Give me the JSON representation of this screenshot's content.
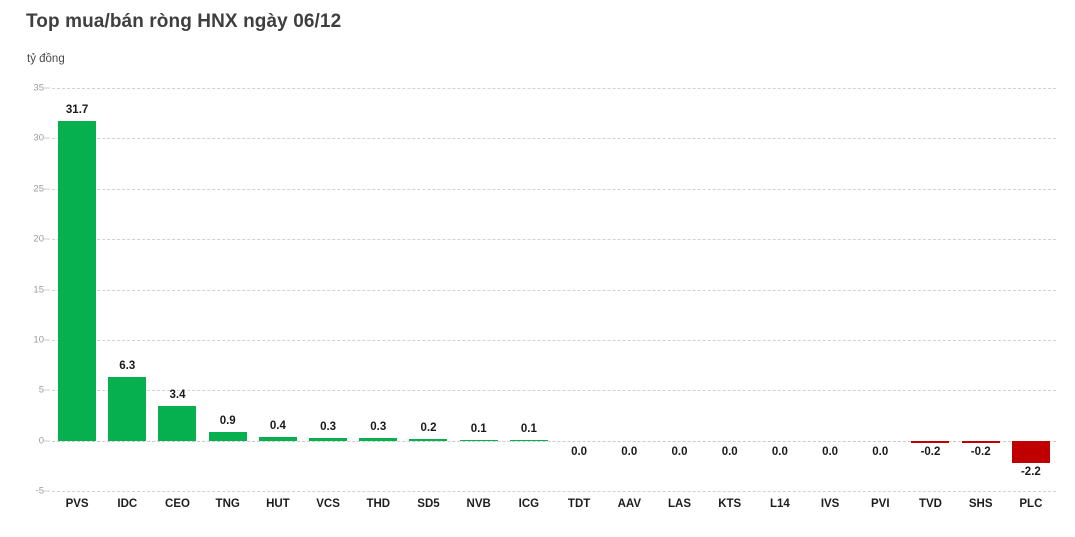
{
  "chart_data": {
    "type": "bar",
    "title": "Top mua/bán ròng HNX ngày 06/12",
    "subtitle": "",
    "unit_label": "tỷ đồng",
    "xlabel": "",
    "ylabel": "tỷ đồng",
    "ylim": [
      -5,
      35
    ],
    "yticks": [
      35,
      30,
      25,
      20,
      15,
      10,
      5,
      0,
      -5
    ],
    "ytick_labels": [
      "35",
      "30",
      "25",
      "20",
      "15",
      "10",
      "5",
      "0",
      "-5"
    ],
    "grid": true,
    "legend": "none",
    "categories": [
      "PVS",
      "IDC",
      "CEO",
      "TNG",
      "HUT",
      "VCS",
      "THD",
      "SD5",
      "NVB",
      "ICG",
      "TDT",
      "AAV",
      "LAS",
      "KTS",
      "L14",
      "IVS",
      "PVI",
      "TVD",
      "SHS",
      "PLC"
    ],
    "values": [
      31.7,
      6.3,
      3.4,
      0.9,
      0.4,
      0.3,
      0.3,
      0.2,
      0.1,
      0.1,
      0.0,
      0.0,
      0.0,
      0.0,
      0.0,
      0.0,
      0.0,
      -0.2,
      -0.2,
      -2.2
    ],
    "value_labels": [
      "31.7",
      "6.3",
      "3.4",
      "0.9",
      "0.4",
      "0.3",
      "0.3",
      "0.2",
      "0.1",
      "0.1",
      "0.0",
      "0.0",
      "0.0",
      "0.0",
      "0.0",
      "0.0",
      "0.0",
      "-0.2",
      "-0.2",
      "-2.2"
    ],
    "colors": {
      "positive": "#07b04e",
      "negative": "#c00000",
      "title": "#3f3f3f",
      "gridline": "#d2d2d2",
      "tick_label": "#9b9b9b",
      "value_label": "#1a1a1a",
      "category_label": "#1d1d1d",
      "background": "#ffffff"
    }
  }
}
